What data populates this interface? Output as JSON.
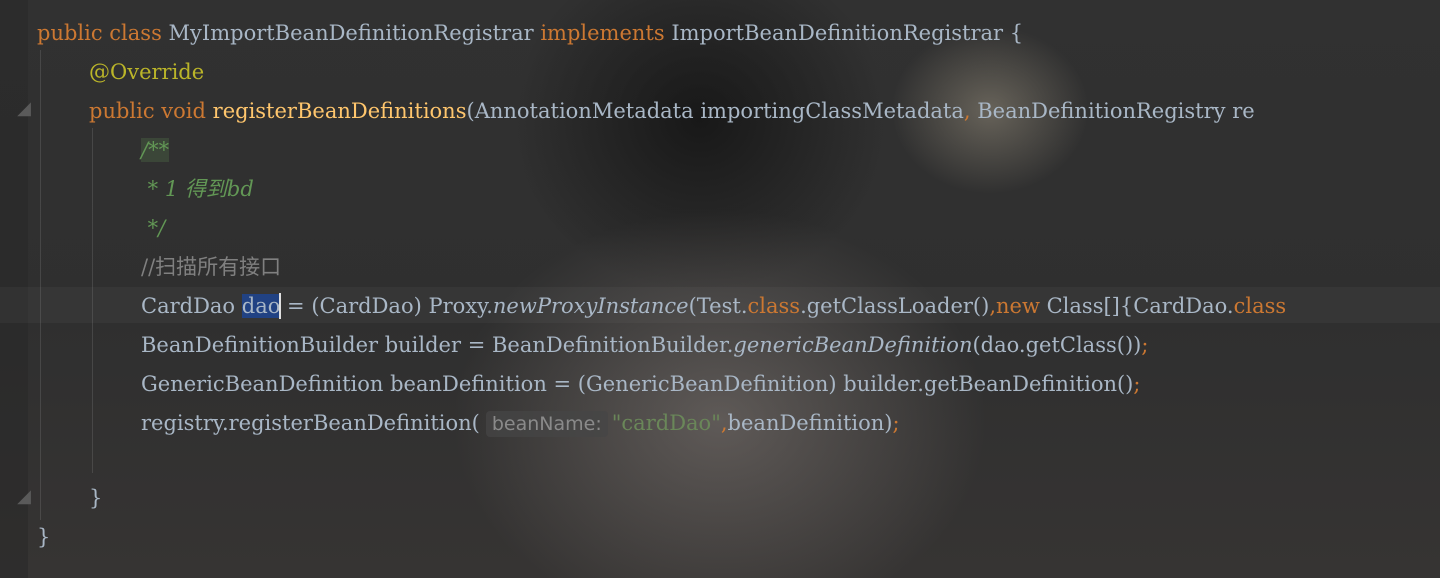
{
  "code": {
    "line1": {
      "kw_public": "public",
      "kw_class": "class",
      "class_name": "MyImportBeanDefinitionRegistrar",
      "kw_implements": "implements",
      "interface_name": "ImportBeanDefinitionRegistrar",
      "brace": "{"
    },
    "line2": {
      "annotation": "@Override"
    },
    "line3": {
      "kw_public": "public",
      "kw_void": "void",
      "method_name": "registerBeanDefinitions",
      "paren_open": "(",
      "param1_type": "AnnotationMetadata",
      "param1_name": "importingClassMetadata",
      "comma": ",",
      "param2_type": "BeanDefinitionRegistry",
      "param2_name_partial": "re"
    },
    "line4": {
      "doc_open": "/**"
    },
    "line5": {
      "doc_text": " * 1 得到bd"
    },
    "line6": {
      "doc_close": " */"
    },
    "line7": {
      "comment": "//扫描所有接口"
    },
    "line8": {
      "type": "CardDao",
      "var_selected": "dao",
      "assign": " = ",
      "cast": "(CardDao)",
      "proxy": " Proxy.",
      "static_method": "newProxyInstance",
      "args_start": "(Test.",
      "kw_class1": "class",
      "get_loader": ".getClassLoader()",
      "comma1": ",",
      "kw_new": "new",
      "class_array": " Class[]{CardDao.",
      "kw_class2": "class"
    },
    "line9": {
      "text1": "BeanDefinitionBuilder builder = BeanDefinitionBuilder.",
      "static_method": "genericBeanDefinition",
      "text2": "(dao.getClass())",
      "semicolon": ";"
    },
    "line10": {
      "text1": "GenericBeanDefinition beanDefinition = (GenericBeanDefinition) builder.getBeanDefinition()",
      "semicolon": ";"
    },
    "line11": {
      "text1": "registry.registerBeanDefinition(",
      "param_hint": "beanName:",
      "string_literal": "\"cardDao\"",
      "comma": ",",
      "text2": "beanDefinition)",
      "semicolon": ";"
    },
    "line13": {
      "brace": "}"
    },
    "line14": {
      "brace": "}"
    }
  },
  "gutter": {
    "fold_icon": "fold-marker-icon"
  },
  "colors": {
    "background": "#2b2b2b",
    "keyword": "#cc7832",
    "annotation": "#bbb529",
    "method_decl": "#ffc66d",
    "doc_comment": "#629755",
    "line_comment": "#808080",
    "identifier": "#a9b7c6",
    "string": "#6a8759",
    "selection": "#214283"
  }
}
